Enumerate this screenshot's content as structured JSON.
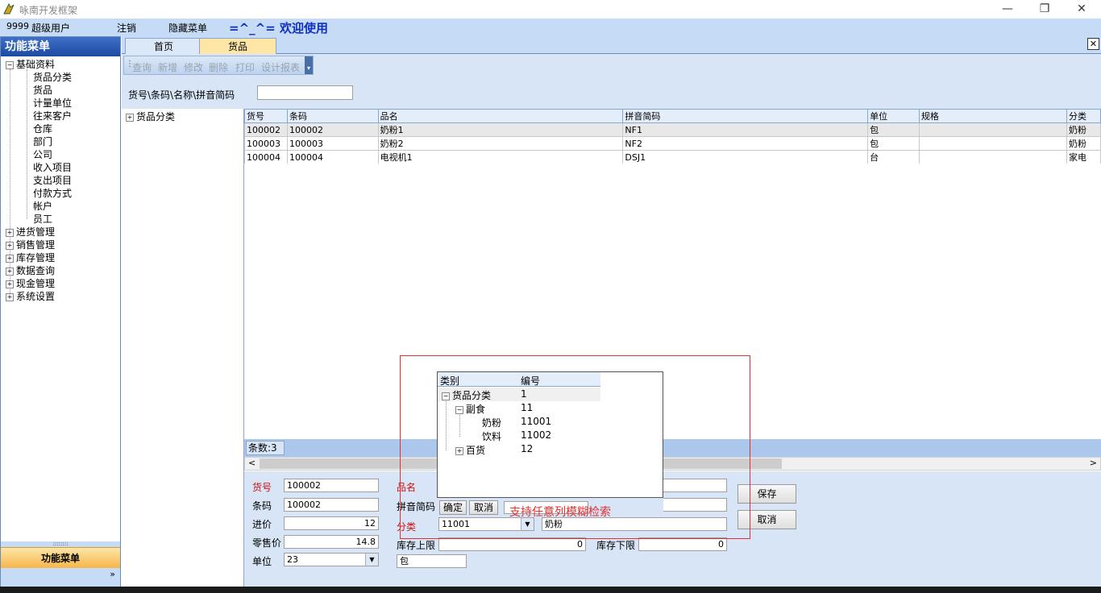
{
  "window": {
    "title": "咏南开发框架",
    "controls": [
      "—",
      "❐",
      "✕"
    ]
  },
  "menubar": {
    "user_id": "9999",
    "user_role": "超级用户",
    "logout": "注销",
    "hide_menu": "隐藏菜单",
    "welcome": "=^_^= 欢迎使用"
  },
  "sidebar": {
    "title": "功能菜单",
    "root": "基础资料",
    "children": [
      "货品分类",
      "货品",
      "计量单位",
      "往来客户",
      "仓库",
      "部门",
      "公司",
      "收入项目",
      "支出项目",
      "付款方式",
      "帐户",
      "员工"
    ],
    "groups": [
      "进货管理",
      "销售管理",
      "库存管理",
      "数据查询",
      "现金管理",
      "系统设置"
    ],
    "footer": "功能菜单",
    "grip": "::::::::",
    "expand": "»"
  },
  "tabs": [
    {
      "label": "首页",
      "active": false
    },
    {
      "label": "货品",
      "active": true
    }
  ],
  "toolbar": {
    "items": [
      "查询",
      "新增",
      "修改",
      "删除",
      "打印",
      "设计报表"
    ]
  },
  "search": {
    "label": "货号\\条码\\名称\\拼音简码",
    "value": ""
  },
  "left_tree": {
    "root": "货品分类"
  },
  "grid": {
    "columns": [
      "货号",
      "条码",
      "品名",
      "拼音简码",
      "单位",
      "规格",
      "分类"
    ],
    "rows": [
      [
        "100002",
        "100002",
        "奶粉1",
        "NF1",
        "包",
        "",
        "奶粉"
      ],
      [
        "100003",
        "100003",
        "奶粉2",
        "NF2",
        "包",
        "",
        "奶粉"
      ],
      [
        "100004",
        "100004",
        "电视机1",
        "DSJ1",
        "台",
        "",
        "家电"
      ]
    ],
    "count": "条数:3"
  },
  "form": {
    "code_label": "货号",
    "code_value": "100002",
    "barcode_label": "条码",
    "barcode_value": "100002",
    "cost_label": "进价",
    "cost_value": "12",
    "retail_label": "零售价",
    "retail_value": "14.8",
    "unit_label": "单位",
    "unit_value": "23",
    "unit_text": "包",
    "name_label": "品名",
    "pinyin_label": "拼音简码",
    "category_label": "分类",
    "category_value": "11001",
    "category_text": "奶粉",
    "stock_max_label": "库存上限",
    "stock_max_value": "0",
    "stock_min_label": "库存下限",
    "stock_min_value": "0",
    "save": "保存",
    "cancel": "取消"
  },
  "popup": {
    "columns": [
      "类别",
      "编号"
    ],
    "rows": [
      {
        "name": "货品分类",
        "code": "1",
        "sign": "−"
      },
      {
        "name": "副食",
        "code": "11",
        "sign": "−"
      },
      {
        "name": "奶粉",
        "code": "11001",
        "sign": ""
      },
      {
        "name": "饮料",
        "code": "11002",
        "sign": ""
      },
      {
        "name": "百货",
        "code": "12",
        "sign": "+"
      }
    ],
    "ok": "确定",
    "cancel": "取消"
  },
  "hint": "支持任意列模糊检索",
  "colors": {
    "accent_blue": "#1c4aa3",
    "tab_active": "#fde6a6",
    "hint_red": "#e03030"
  }
}
